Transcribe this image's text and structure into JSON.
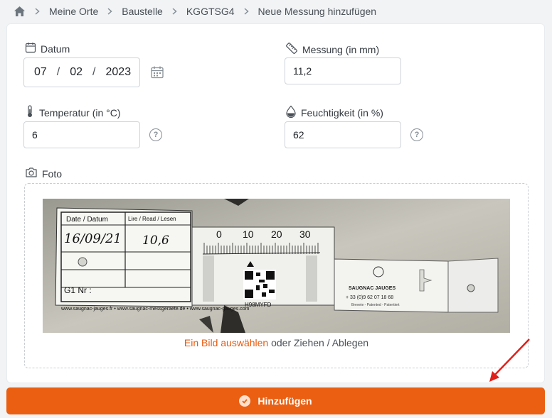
{
  "breadcrumb": {
    "items": [
      "Meine Orte",
      "Baustelle",
      "KGGTSG4",
      "Neue Messung hinzufügen"
    ]
  },
  "form": {
    "datum": {
      "label": "Datum",
      "day": "07",
      "month": "02",
      "year": "2023",
      "separator": "/"
    },
    "messung": {
      "label": "Messung (in mm)",
      "value": "11,2"
    },
    "temperatur": {
      "label": "Temperatur (in °C)",
      "value": "6"
    },
    "feuchtigkeit": {
      "label": "Feuchtigkeit (in %)",
      "value": "62"
    },
    "foto": {
      "label": "Foto",
      "select_link": "Ein Bild auswählen",
      "drop_hint": " oder Ziehen / Ablegen"
    }
  },
  "photo_content": {
    "header_date": "Date / Datum",
    "header_read": "Lire / Read / Lesen",
    "date_value": "16/09/21",
    "read_value": "10,6",
    "g1": "G1  Nr :",
    "scale": [
      "0",
      "10",
      "20",
      "30"
    ],
    "qr_code": "H98MYFD",
    "footer": "www.saugnac-jauges.fr  •  www.saugnac-messgeraete.de  •  www.saugnac-gauges.com",
    "brand": "SAUGNAC JAUGES",
    "phone": "+ 33 (0)9 62 07 18 68",
    "brand_small": "Brevete - Patented - Patentiert"
  },
  "submit": {
    "label": "Hinzufügen"
  },
  "colors": {
    "accent": "#ea5f12",
    "link": "#e8590c"
  },
  "icons": {
    "home": "home-icon",
    "separator": "chevron-right-icon",
    "calendar": "calendar-icon",
    "ruler": "ruler-icon",
    "thermometer": "thermometer-icon",
    "drop": "droplet-icon",
    "camera": "camera-icon",
    "help": "question-circle-icon",
    "check": "check-circle-icon"
  }
}
